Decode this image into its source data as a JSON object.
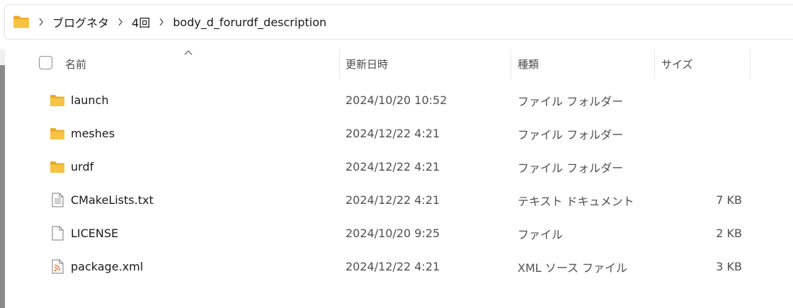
{
  "breadcrumb": {
    "root_icon": "folder-icon",
    "items": [
      "ブログネタ",
      "4回",
      "body_d_forurdf_description"
    ]
  },
  "header": {
    "name": "名前",
    "date": "更新日時",
    "type": "種類",
    "size": "サイズ"
  },
  "files": [
    {
      "name": "launch",
      "date": "2024/10/20 10:52",
      "type": "ファイル フォルダー",
      "size": "",
      "icon": "folder-icon"
    },
    {
      "name": "meshes",
      "date": "2024/12/22 4:21",
      "type": "ファイル フォルダー",
      "size": "",
      "icon": "folder-icon"
    },
    {
      "name": "urdf",
      "date": "2024/12/22 4:21",
      "type": "ファイル フォルダー",
      "size": "",
      "icon": "folder-icon"
    },
    {
      "name": "CMakeLists.txt",
      "date": "2024/12/22 4:21",
      "type": "テキスト ドキュメント",
      "size": "7 KB",
      "icon": "text-file-icon"
    },
    {
      "name": "LICENSE",
      "date": "2024/10/20 9:25",
      "type": "ファイル",
      "size": "2 KB",
      "icon": "blank-file-icon"
    },
    {
      "name": "package.xml",
      "date": "2024/12/22 4:21",
      "type": "XML ソース ファイル",
      "size": "3 KB",
      "icon": "xml-file-icon"
    }
  ],
  "colors": {
    "folder": "#f6c342",
    "folder_dark": "#e9a82a",
    "rss": "#e8762d",
    "text_muted": "#505050"
  }
}
